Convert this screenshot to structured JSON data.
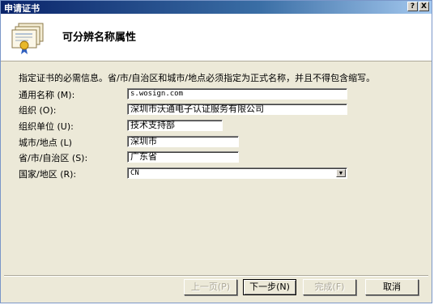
{
  "window": {
    "title": "申请证书",
    "help_label": "?",
    "close_label": "X"
  },
  "header": {
    "title": "可分辨名称属性",
    "icon": "certificate-icon"
  },
  "instruction": "指定证书的必需信息。省/市/自治区和城市/地点必须指定为正式名称，并且不得包含缩写。",
  "form": {
    "common_name": {
      "label": "通用名称 (M):",
      "value": "s.wosign.com"
    },
    "organization": {
      "label": "组织 (O):",
      "value": "深圳市沃通电子认证服务有限公司"
    },
    "org_unit": {
      "label": "组织单位 (U):",
      "value": "技术支持部"
    },
    "city": {
      "label": "城市/地点 (L)",
      "value": "深圳市"
    },
    "state": {
      "label": "省/市/自治区 (S):",
      "value": "广东省"
    },
    "country": {
      "label": "国家/地区 (R):",
      "value": "CN"
    }
  },
  "buttons": {
    "back": "上一页(P)",
    "next": "下一步(N)",
    "finish": "完成(F)",
    "cancel": "取消"
  }
}
